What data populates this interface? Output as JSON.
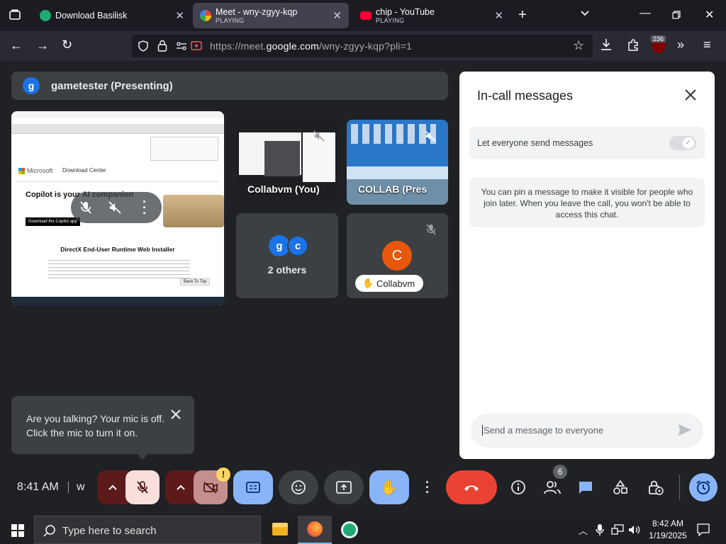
{
  "tabs": [
    {
      "title": "Download Basilisk",
      "status": ""
    },
    {
      "title": "Meet - wny-zgyy-kqp",
      "status": "PLAYING"
    },
    {
      "title": "chip - YouTube",
      "status": "PLAYING"
    }
  ],
  "url": {
    "prefix": "https://meet.",
    "domain": "google.com",
    "path": "/wny-zgyy-kqp?pli=1"
  },
  "extension_badge": "236",
  "presenting": {
    "avatar": "g",
    "label": "gametester (Presenting)"
  },
  "tiles": {
    "collabvm_you": "Collabvm (You)",
    "collab_pres": "COLLAB (Pres",
    "others": {
      "a1": "g",
      "a2": "c",
      "label": "2 others"
    },
    "collabvm": {
      "avatar": "C",
      "label": "Collabvm"
    }
  },
  "screen_share": {
    "headline": "Copilot is your AI companion",
    "download_btn": "Download the Copilot app",
    "title": "DirectX End-User Runtime Web Installer",
    "back_to_top": "Back To Top",
    "brand": "Microsoft",
    "download_center": "Download Center"
  },
  "chat": {
    "title": "In-call messages",
    "toggle_label": "Let everyone send messages",
    "info": "You can pin a message to make it visible for people who join later. When you leave the call, you won't be able to access this chat.",
    "input_placeholder": "Send a message to everyone"
  },
  "toast": {
    "text": "Are you talking? Your mic is off. Click the mic to turn it on."
  },
  "toolbar": {
    "time": "8:41 AM",
    "meeting_code_initial": "w",
    "people_count": "6",
    "warning": "!"
  },
  "taskbar": {
    "search_placeholder": "Type here to search",
    "time": "8:42 AM",
    "date": "1/19/2025"
  },
  "colors": {
    "accent": "#8ab4f8",
    "danger": "#ea4335",
    "mic_off_bg": "#f9dedc",
    "panel": "#3c4043"
  }
}
